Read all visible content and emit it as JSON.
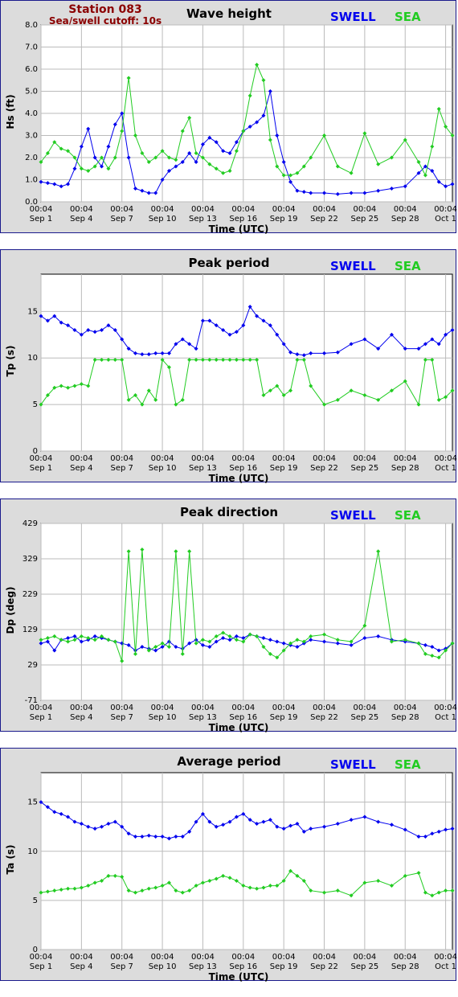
{
  "header": {
    "station": "Station 083",
    "cutoff": "Sea/swell cutoff: 10s"
  },
  "legend": {
    "swell": "SWELL",
    "sea": "SEA"
  },
  "colors": {
    "swell": "#0000ee",
    "sea": "#22cc22",
    "frame": "#1a1a8c",
    "title_dark": "#8b0000"
  },
  "xaxis": {
    "label": "Time (UTC)",
    "tick_days": [
      0,
      3,
      6,
      9,
      12,
      15,
      18,
      21,
      24,
      27,
      30
    ],
    "tick_time": "00:04",
    "tick_dates": [
      "Sep 1",
      "Sep 4",
      "Sep 7",
      "Sep 10",
      "Sep 13",
      "Sep 16",
      "Sep 19",
      "Sep 22",
      "Sep 25",
      "Sep 28",
      "Oct 1"
    ],
    "range_days": [
      0,
      30.5
    ]
  },
  "chart_data": [
    {
      "type": "line",
      "title": "Wave height",
      "ylabel": "Hs (ft)",
      "ylim": [
        0,
        8
      ],
      "yticks": [
        "0.0",
        "1.0",
        "2.0",
        "3.0",
        "4.0",
        "5.0",
        "6.0",
        "7.0",
        "8.0"
      ],
      "ytick_values": [
        0,
        1,
        2,
        3,
        4,
        5,
        6,
        7,
        8
      ],
      "grid": true,
      "series": [
        {
          "name": "SWELL",
          "x": [
            0,
            0.5,
            1,
            1.5,
            2,
            2.5,
            3,
            3.5,
            4,
            4.5,
            5,
            5.5,
            6,
            6.5,
            7,
            7.5,
            8,
            8.5,
            9,
            9.5,
            10,
            10.5,
            11,
            11.5,
            12,
            12.5,
            13,
            13.5,
            14,
            14.5,
            15,
            15.5,
            16,
            16.5,
            17,
            17.5,
            18,
            18.5,
            19,
            19.5,
            20,
            21,
            22,
            23,
            24,
            25,
            26,
            27,
            28,
            28.5,
            29,
            29.5,
            30,
            30.5
          ],
          "y": [
            0.9,
            0.85,
            0.8,
            0.7,
            0.8,
            1.5,
            2.5,
            3.3,
            2.0,
            1.6,
            2.5,
            3.5,
            4.0,
            2.0,
            0.6,
            0.5,
            0.4,
            0.4,
            1.0,
            1.4,
            1.6,
            1.8,
            2.2,
            1.8,
            2.6,
            2.9,
            2.7,
            2.3,
            2.2,
            2.7,
            3.2,
            3.4,
            3.6,
            3.9,
            5.0,
            3.0,
            1.8,
            0.9,
            0.5,
            0.45,
            0.4,
            0.4,
            0.35,
            0.4,
            0.4,
            0.5,
            0.6,
            0.7,
            1.3,
            1.6,
            1.4,
            0.9,
            0.7,
            0.8
          ]
        },
        {
          "name": "SEA",
          "x": [
            0,
            0.5,
            1,
            1.5,
            2,
            2.5,
            3,
            3.5,
            4,
            4.5,
            5,
            5.5,
            6,
            6.5,
            7,
            7.5,
            8,
            8.5,
            9,
            9.5,
            10,
            10.5,
            11,
            11.5,
            12,
            12.5,
            13,
            13.5,
            14,
            14.5,
            15,
            15.5,
            16,
            16.5,
            17,
            17.5,
            18,
            18.5,
            19,
            19.5,
            20,
            21,
            22,
            23,
            24,
            25,
            26,
            27,
            28,
            28.5,
            29,
            29.5,
            30,
            30.5
          ],
          "y": [
            1.8,
            2.2,
            2.7,
            2.4,
            2.3,
            2.0,
            1.5,
            1.4,
            1.6,
            2.0,
            1.5,
            2.0,
            3.2,
            5.6,
            3.0,
            2.2,
            1.8,
            2.0,
            2.3,
            2.0,
            1.9,
            3.2,
            3.8,
            2.2,
            2.0,
            1.7,
            1.5,
            1.3,
            1.4,
            2.3,
            3.2,
            4.8,
            6.2,
            5.5,
            2.8,
            1.6,
            1.2,
            1.2,
            1.3,
            1.6,
            2.0,
            3.0,
            1.6,
            1.3,
            3.1,
            1.7,
            2.0,
            2.8,
            1.8,
            1.2,
            2.5,
            4.2,
            3.4,
            3.0
          ]
        }
      ]
    },
    {
      "type": "scatter",
      "title": "Peak period",
      "ylabel": "Tp (s)",
      "ylim": [
        0,
        19
      ],
      "yticks": [
        "0",
        "5",
        "10",
        "15"
      ],
      "ytick_values": [
        0,
        5,
        10,
        15
      ],
      "grid": true,
      "series": [
        {
          "name": "SWELL",
          "x": [
            0,
            0.5,
            1,
            1.5,
            2,
            2.5,
            3,
            3.5,
            4,
            4.5,
            5,
            5.5,
            6,
            6.5,
            7,
            7.5,
            8,
            8.5,
            9,
            9.5,
            10,
            10.5,
            11,
            11.5,
            12,
            12.5,
            13,
            13.5,
            14,
            14.5,
            15,
            15.5,
            16,
            16.5,
            17,
            17.5,
            18,
            18.5,
            19,
            19.5,
            20,
            21,
            22,
            23,
            24,
            25,
            26,
            27,
            28,
            28.5,
            29,
            29.5,
            30,
            30.5
          ],
          "y": [
            14.5,
            14.0,
            14.5,
            13.8,
            13.5,
            13.0,
            12.5,
            13.0,
            12.8,
            13.0,
            13.5,
            13.0,
            12.0,
            11.0,
            10.5,
            10.4,
            10.4,
            10.5,
            10.5,
            10.5,
            11.5,
            12.0,
            11.5,
            11.0,
            14.0,
            14.0,
            13.5,
            13.0,
            12.5,
            12.8,
            13.5,
            15.5,
            14.5,
            14.0,
            13.5,
            12.5,
            11.5,
            10.6,
            10.4,
            10.3,
            10.5,
            10.5,
            10.6,
            11.5,
            12.0,
            11.0,
            12.5,
            11.0,
            11.0,
            11.5,
            12.0,
            11.5,
            12.5,
            13.0
          ]
        },
        {
          "name": "SEA",
          "x": [
            0,
            0.5,
            1,
            1.5,
            2,
            2.5,
            3,
            3.5,
            4,
            4.5,
            5,
            5.5,
            6,
            6.5,
            7,
            7.5,
            8,
            8.5,
            9,
            9.5,
            10,
            10.5,
            11,
            11.5,
            12,
            12.5,
            13,
            13.5,
            14,
            14.5,
            15,
            15.5,
            16,
            16.5,
            17,
            17.5,
            18,
            18.5,
            19,
            19.5,
            20,
            21,
            22,
            23,
            24,
            25,
            26,
            27,
            28,
            28.5,
            29,
            29.5,
            30,
            30.5
          ],
          "y": [
            5.0,
            6.0,
            6.8,
            7.0,
            6.8,
            7.0,
            7.2,
            7.0,
            9.8,
            9.8,
            9.8,
            9.8,
            9.8,
            5.5,
            6.0,
            5.0,
            6.5,
            5.5,
            9.8,
            9.0,
            5.0,
            5.5,
            9.8,
            9.8,
            9.8,
            9.8,
            9.8,
            9.8,
            9.8,
            9.8,
            9.8,
            9.8,
            9.8,
            6.0,
            6.5,
            7.0,
            6.0,
            6.5,
            9.8,
            9.8,
            7.0,
            5.0,
            5.5,
            6.5,
            6.0,
            5.5,
            6.5,
            7.5,
            5.0,
            9.8,
            9.8,
            5.5,
            5.8,
            6.5
          ]
        }
      ]
    },
    {
      "type": "scatter",
      "title": "Peak direction",
      "ylabel": "Dp (deg)",
      "ylim": [
        -71,
        429
      ],
      "yticks": [
        "-71",
        "29",
        "129",
        "229",
        "329",
        "429"
      ],
      "ytick_values": [
        -71,
        29,
        129,
        229,
        329,
        429
      ],
      "grid": true,
      "series": [
        {
          "name": "SWELL",
          "x": [
            0,
            0.5,
            1,
            1.5,
            2,
            2.5,
            3,
            3.5,
            4,
            4.5,
            5,
            5.5,
            6,
            6.5,
            7,
            7.5,
            8,
            8.5,
            9,
            9.5,
            10,
            10.5,
            11,
            11.5,
            12,
            12.5,
            13,
            13.5,
            14,
            14.5,
            15,
            15.5,
            16,
            16.5,
            17,
            17.5,
            18,
            18.5,
            19,
            19.5,
            20,
            21,
            22,
            23,
            24,
            25,
            26,
            27,
            28,
            28.5,
            29,
            29.5,
            30,
            30.5
          ],
          "y": [
            90,
            95,
            70,
            100,
            105,
            110,
            95,
            100,
            110,
            105,
            100,
            95,
            90,
            85,
            70,
            80,
            75,
            70,
            80,
            95,
            80,
            75,
            90,
            100,
            85,
            80,
            95,
            105,
            100,
            110,
            105,
            115,
            110,
            105,
            100,
            95,
            90,
            85,
            80,
            90,
            100,
            95,
            90,
            85,
            105,
            110,
            100,
            95,
            90,
            85,
            80,
            70,
            75,
            90
          ]
        },
        {
          "name": "SEA",
          "x": [
            0,
            0.5,
            1,
            1.5,
            2,
            2.5,
            3,
            3.5,
            4,
            4.5,
            5,
            5.5,
            6,
            6.5,
            7,
            7.5,
            8,
            8.5,
            9,
            9.5,
            10,
            10.5,
            11,
            11.5,
            12,
            12.5,
            13,
            13.5,
            14,
            14.5,
            15,
            15.5,
            16,
            16.5,
            17,
            17.5,
            18,
            18.5,
            19,
            19.5,
            20,
            21,
            22,
            23,
            24,
            25,
            26,
            27,
            28,
            28.5,
            29,
            29.5,
            30,
            30.5
          ],
          "y": [
            100,
            105,
            110,
            100,
            95,
            100,
            110,
            105,
            100,
            110,
            100,
            95,
            40,
            350,
            60,
            355,
            70,
            80,
            90,
            80,
            350,
            60,
            350,
            90,
            100,
            95,
            110,
            120,
            110,
            100,
            95,
            115,
            110,
            80,
            60,
            50,
            70,
            90,
            100,
            95,
            110,
            115,
            100,
            95,
            140,
            350,
            95,
            100,
            90,
            60,
            55,
            50,
            70,
            90
          ]
        }
      ]
    },
    {
      "type": "scatter",
      "title": "Average period",
      "ylabel": "Ta (s)",
      "ylim": [
        0,
        18
      ],
      "yticks": [
        "0",
        "5",
        "10",
        "15"
      ],
      "ytick_values": [
        0,
        5,
        10,
        15
      ],
      "grid": true,
      "series": [
        {
          "name": "SWELL",
          "x": [
            0,
            0.5,
            1,
            1.5,
            2,
            2.5,
            3,
            3.5,
            4,
            4.5,
            5,
            5.5,
            6,
            6.5,
            7,
            7.5,
            8,
            8.5,
            9,
            9.5,
            10,
            10.5,
            11,
            11.5,
            12,
            12.5,
            13,
            13.5,
            14,
            14.5,
            15,
            15.5,
            16,
            16.5,
            17,
            17.5,
            18,
            18.5,
            19,
            19.5,
            20,
            21,
            22,
            23,
            24,
            25,
            26,
            27,
            28,
            28.5,
            29,
            29.5,
            30,
            30.5
          ],
          "y": [
            15.0,
            14.5,
            14.0,
            13.8,
            13.5,
            13.0,
            12.8,
            12.5,
            12.3,
            12.5,
            12.8,
            13.0,
            12.5,
            11.8,
            11.5,
            11.5,
            11.6,
            11.5,
            11.5,
            11.3,
            11.5,
            11.5,
            12.0,
            13.0,
            13.8,
            13.0,
            12.5,
            12.7,
            13.0,
            13.5,
            13.8,
            13.2,
            12.8,
            13.0,
            13.2,
            12.5,
            12.3,
            12.6,
            12.8,
            12.0,
            12.3,
            12.5,
            12.8,
            13.2,
            13.5,
            13.0,
            12.7,
            12.2,
            11.5,
            11.5,
            11.8,
            12.0,
            12.2,
            12.3
          ]
        },
        {
          "name": "SEA",
          "x": [
            0,
            0.5,
            1,
            1.5,
            2,
            2.5,
            3,
            3.5,
            4,
            4.5,
            5,
            5.5,
            6,
            6.5,
            7,
            7.5,
            8,
            8.5,
            9,
            9.5,
            10,
            10.5,
            11,
            11.5,
            12,
            12.5,
            13,
            13.5,
            14,
            14.5,
            15,
            15.5,
            16,
            16.5,
            17,
            17.5,
            18,
            18.5,
            19,
            19.5,
            20,
            21,
            22,
            23,
            24,
            25,
            26,
            27,
            28,
            28.5,
            29,
            29.5,
            30,
            30.5
          ],
          "y": [
            5.8,
            5.9,
            6.0,
            6.1,
            6.2,
            6.2,
            6.3,
            6.5,
            6.8,
            7.0,
            7.5,
            7.5,
            7.4,
            6.0,
            5.8,
            6.0,
            6.2,
            6.3,
            6.5,
            6.8,
            6.0,
            5.8,
            6.0,
            6.5,
            6.8,
            7.0,
            7.2,
            7.5,
            7.3,
            7.0,
            6.5,
            6.3,
            6.2,
            6.3,
            6.5,
            6.5,
            7.0,
            8.0,
            7.5,
            7.0,
            6.0,
            5.8,
            6.0,
            5.5,
            6.8,
            7.0,
            6.5,
            7.5,
            7.8,
            5.8,
            5.5,
            5.8,
            6.0,
            6.0
          ]
        }
      ]
    }
  ]
}
